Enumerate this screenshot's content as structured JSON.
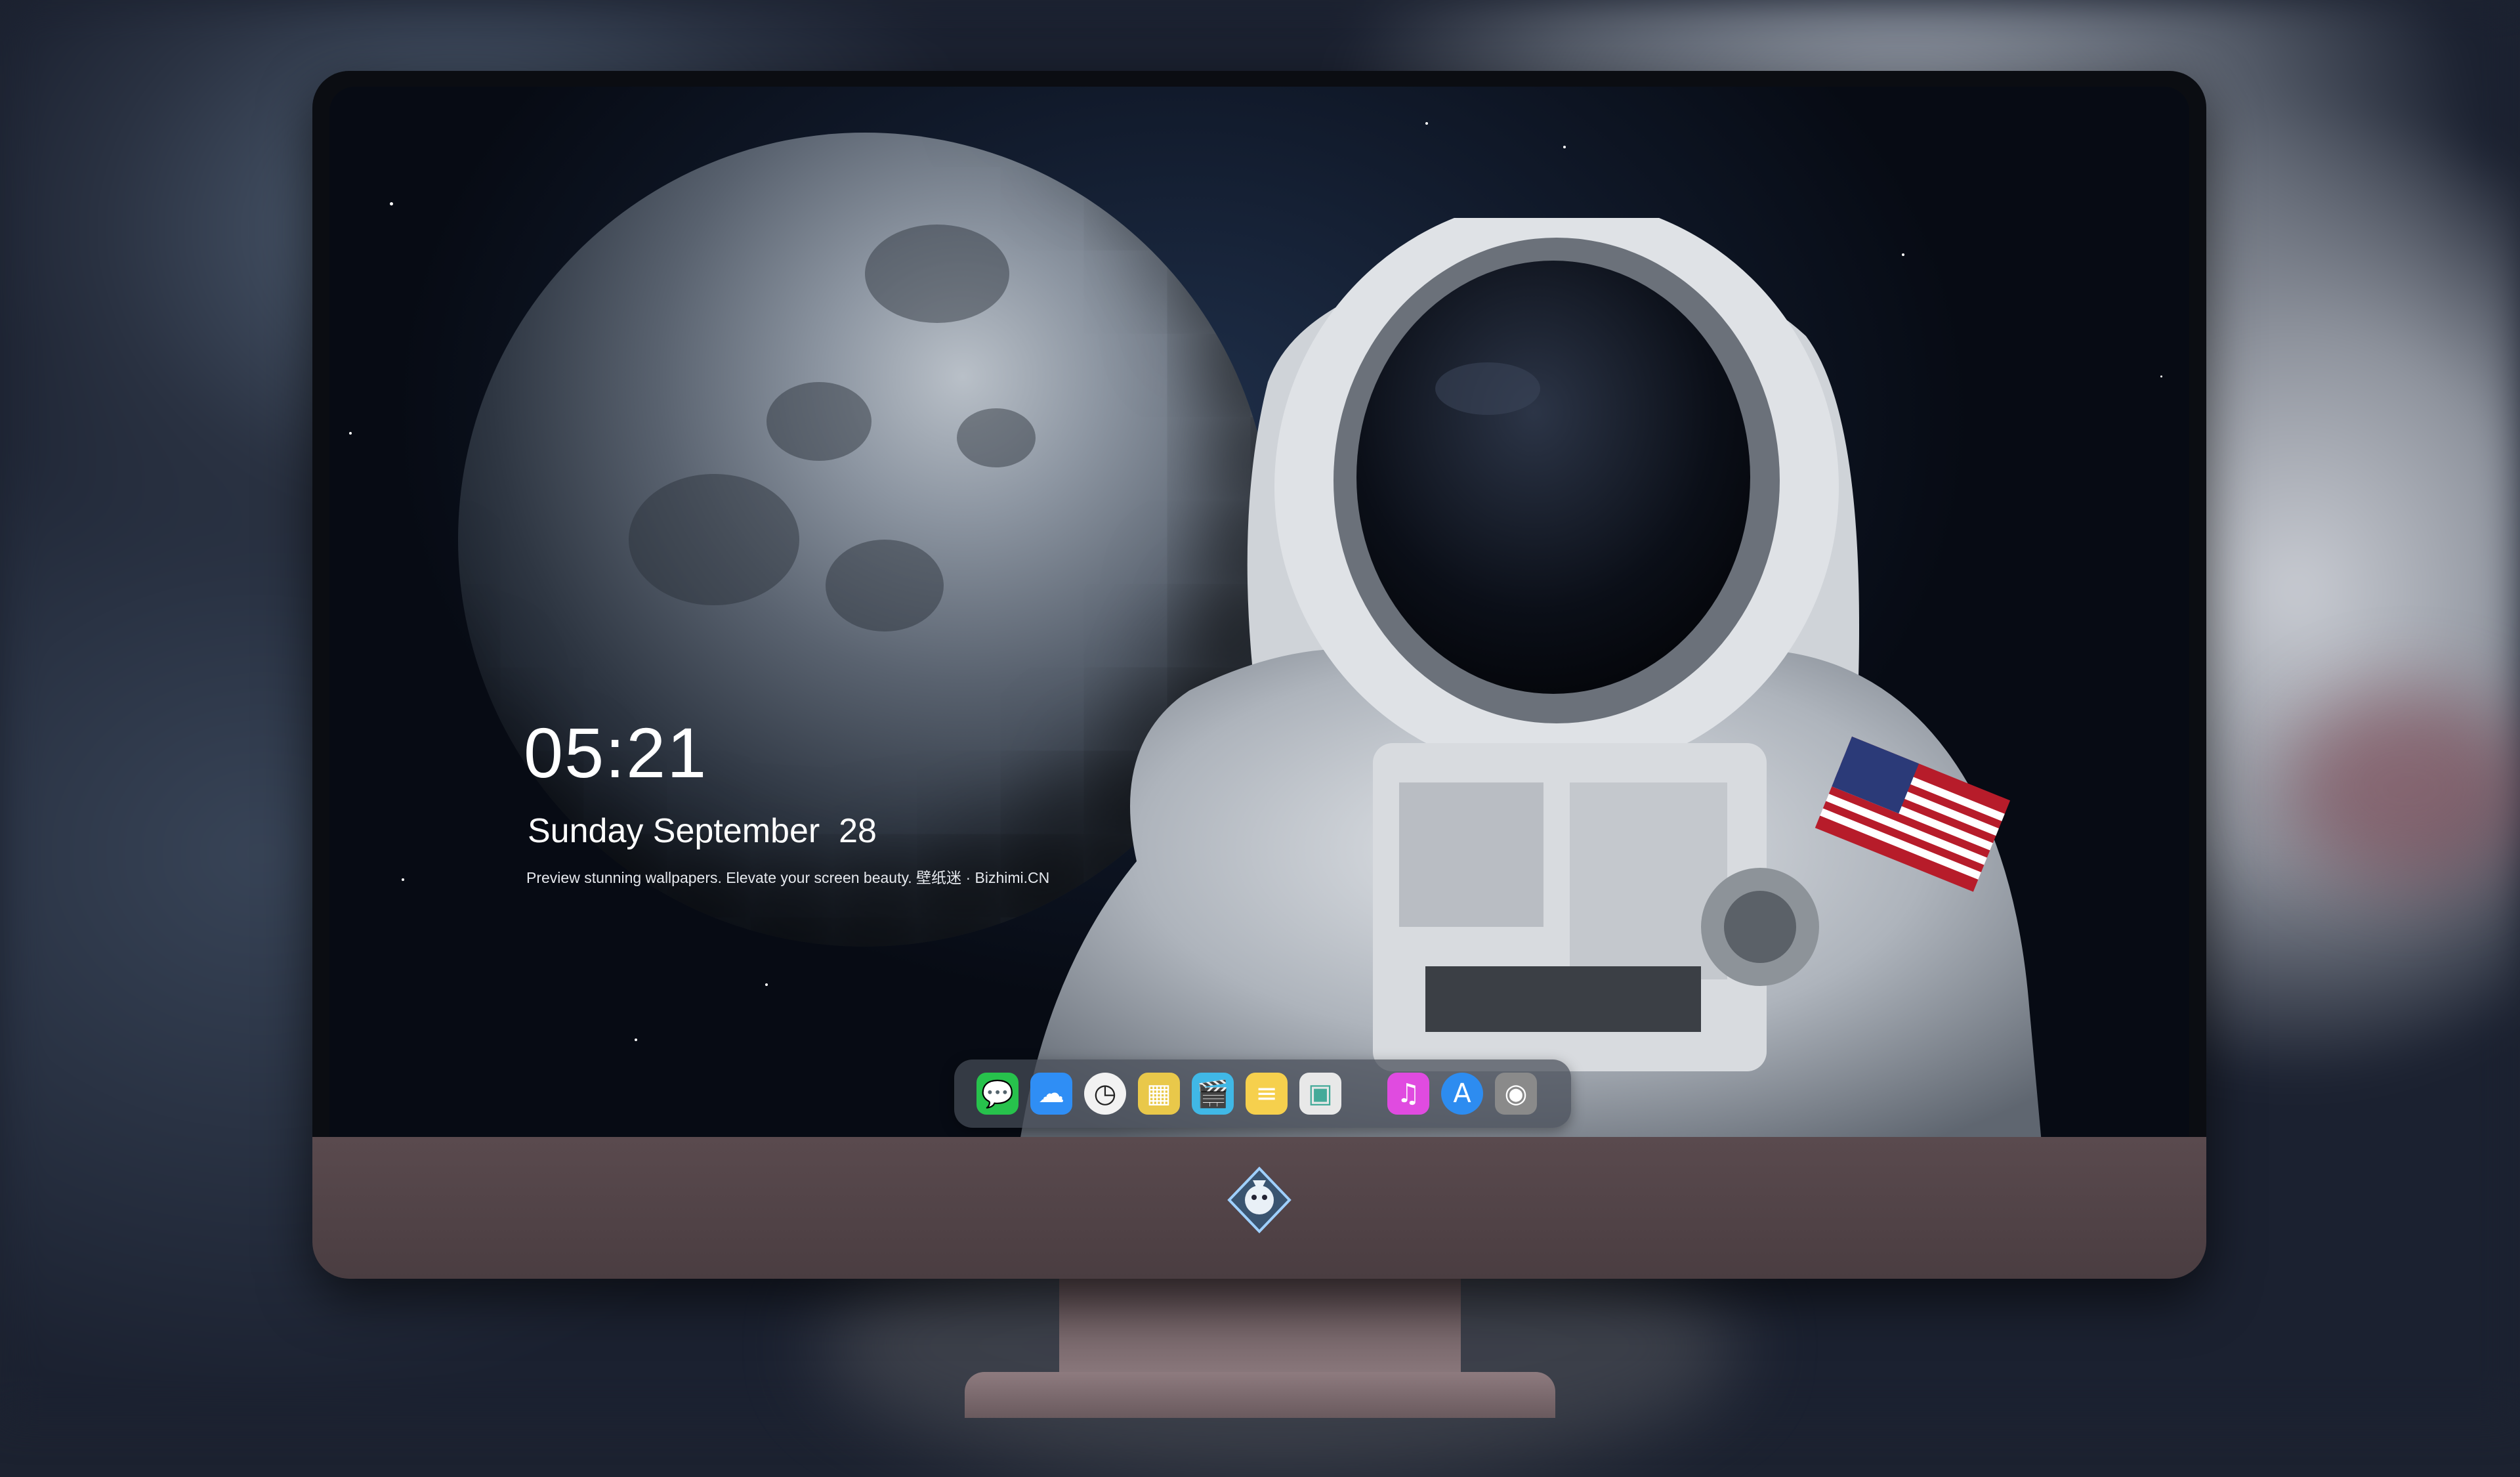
{
  "lockscreen": {
    "time": "05:21",
    "date": "Sunday September  28",
    "tagline": "Preview stunning wallpapers. Elevate your screen beauty. 壁纸迷 · Bizhimi.CN"
  },
  "dock": {
    "items": [
      {
        "name": "messages-icon",
        "glyph": "💬",
        "color": "#27c24c"
      },
      {
        "name": "weather-icon",
        "glyph": "☁",
        "color": "#2f8ef5"
      },
      {
        "name": "clock-icon",
        "glyph": "◷",
        "color": "#f2f2f2"
      },
      {
        "name": "preview-icon",
        "glyph": "▦",
        "color": "#e9c84a"
      },
      {
        "name": "clips-icon",
        "glyph": "🎬",
        "color": "#40b8e6"
      },
      {
        "name": "notes-icon",
        "glyph": "≡",
        "color": "#f6d04d"
      },
      {
        "name": "photos-icon",
        "glyph": "▣",
        "color": "#e8e8e8"
      },
      {
        "name": "itunes-icon",
        "glyph": "♫",
        "color": "#e04be0"
      },
      {
        "name": "app-store-icon",
        "glyph": "A",
        "color": "#2d8cf0"
      },
      {
        "name": "camera-icon",
        "glyph": "◉",
        "color": "#8a8a8a"
      }
    ]
  }
}
